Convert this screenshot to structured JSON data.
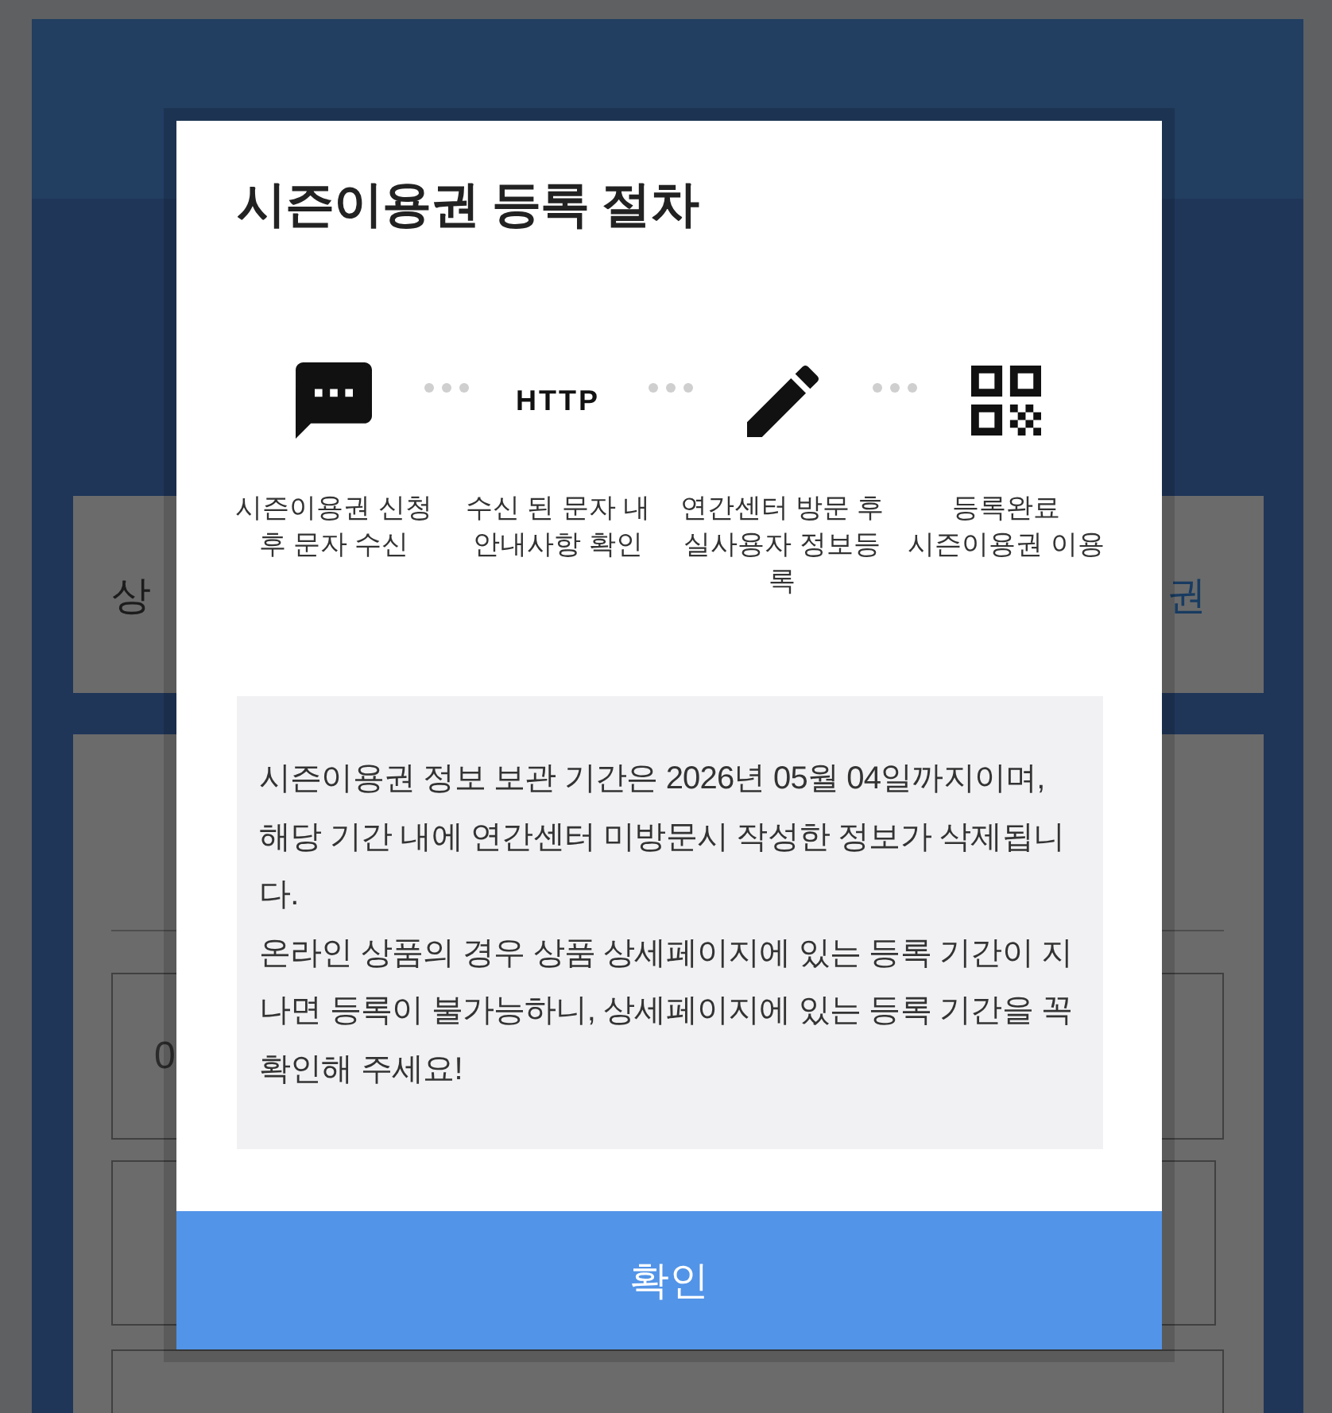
{
  "page": {
    "product_card": {
      "label": "상",
      "link": "권"
    },
    "fields": [
      {
        "kind": "input",
        "value": "0"
      },
      {
        "kind": "input"
      },
      {
        "kind": "input"
      }
    ]
  },
  "modal": {
    "title": "시즌이용권 등록 절차",
    "steps": [
      {
        "kind": "chat",
        "label": "시즌이용권 신청 후 문자 수신"
      },
      {
        "kind": "text",
        "icon_text": "HTTP",
        "label": "수신 된 문자 내 안내사항 확인"
      },
      {
        "kind": "pencil",
        "label": "연간센터 방문 후 실사용자 정보등록"
      },
      {
        "kind": "qr",
        "label": "등록완료\n시즌이용권 이용"
      }
    ],
    "notice": [
      "시즌이용권 정보 보관 기간은 2026년 05월 04일까지이며, 해당 기간 내에 연간센터 미방문시 작성한 정보가 삭제됩니다.",
      "온라인 상품의 경우 상품 상세페이지에 있는 등록 기간이 지나면 등록이 불가능하니, 상세페이지에 있는 등록 기간을 꼭 확인해 주세요!"
    ],
    "confirm_button": "확인"
  }
}
